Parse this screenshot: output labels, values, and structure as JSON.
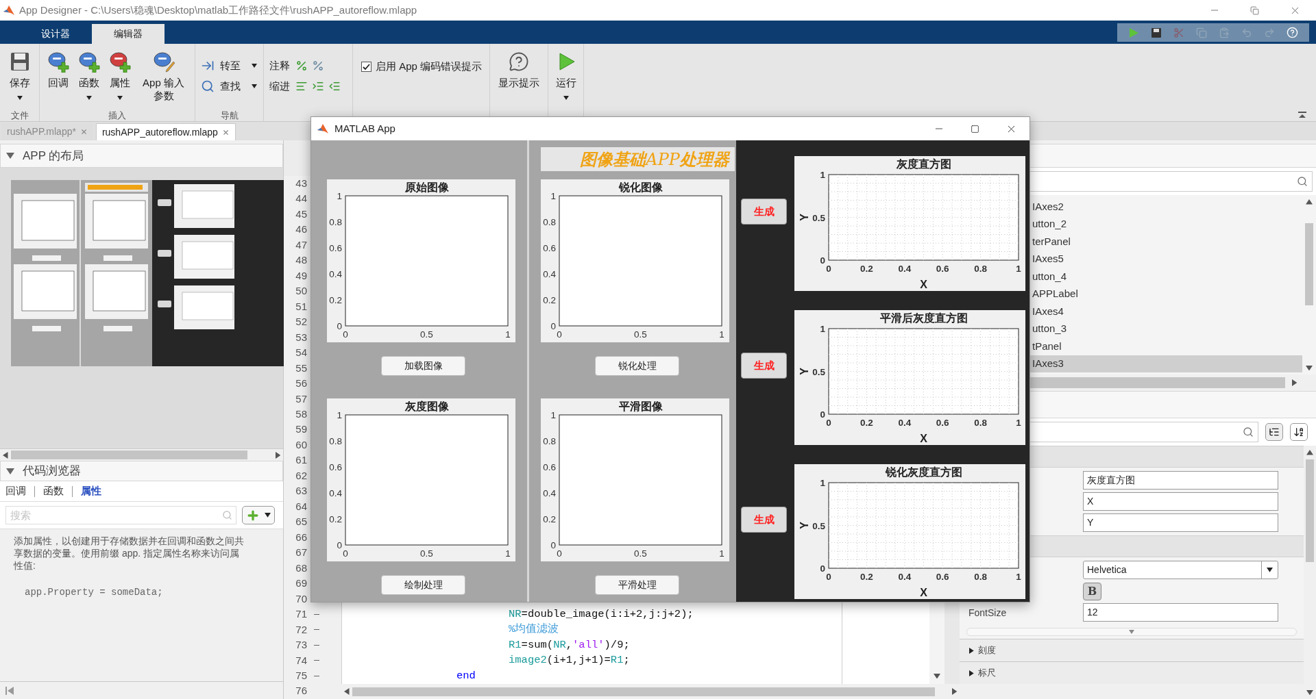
{
  "window": {
    "title": "App Designer - C:\\Users\\稳魂\\Desktop\\matlab工作路径文件\\rushAPP_autoreflow.mlapp"
  },
  "main_tabs": [
    {
      "label": "设计器",
      "selected": false
    },
    {
      "label": "编辑器",
      "selected": true
    }
  ],
  "ribbon": {
    "groups": [
      {
        "kind": "large",
        "label": "文件",
        "buttons": [
          {
            "label": "保存",
            "menu": true
          }
        ]
      },
      {
        "kind": "large",
        "label": "插入",
        "buttons": [
          {
            "label": "回调",
            "menu": false
          },
          {
            "label": "函数",
            "menu": true
          },
          {
            "label": "属性",
            "menu": true
          },
          {
            "label": "App 输入参数",
            "menu": false
          }
        ]
      },
      {
        "kind": "small",
        "label": "导航",
        "buttons": [
          {
            "label": "转至",
            "menu": true
          },
          {
            "label": "查找",
            "menu": true
          }
        ]
      },
      {
        "kind": "edit",
        "buttons": [
          {
            "label": "注释"
          },
          {
            "label": "缩进"
          }
        ]
      },
      {
        "kind": "check",
        "checkbox": {
          "label": "启用 App 编码错误提示",
          "checked": true
        }
      },
      {
        "kind": "large",
        "buttons": [
          {
            "label": "显示提示",
            "menu": false
          }
        ]
      },
      {
        "kind": "large",
        "buttons": [
          {
            "label": "运行",
            "menu": true
          }
        ]
      }
    ]
  },
  "file_tabs": [
    {
      "label": "rushAPP.mlapp*",
      "selected": false
    },
    {
      "label": "rushAPP_autoreflow.mlapp",
      "selected": true
    }
  ],
  "layout_panel": {
    "title": "APP 的布局",
    "expanded": true
  },
  "code_browser": {
    "title": "代码浏览器",
    "expanded": true,
    "tabs": [
      {
        "label": "回调",
        "selected": false
      },
      {
        "label": "函数",
        "selected": false
      },
      {
        "label": "属性",
        "selected": true
      }
    ],
    "search": {
      "placeholder": "搜索"
    },
    "description": "添加属性，以创建用于存储数据并在回调和函数之间共享数据的变量。使用前缀 app. 指定属性名称来访问属性值:",
    "example": "app.Property = someData;"
  },
  "editor": {
    "rows": [
      {
        "number": "43"
      },
      {
        "number": "44"
      },
      {
        "number": "45"
      },
      {
        "number": "46"
      },
      {
        "number": "47"
      },
      {
        "number": "48"
      },
      {
        "number": "49"
      },
      {
        "number": "50"
      },
      {
        "number": "51"
      },
      {
        "number": "52"
      },
      {
        "number": "53"
      },
      {
        "number": "54"
      },
      {
        "number": "55"
      },
      {
        "number": "56"
      },
      {
        "number": "57"
      },
      {
        "number": "58"
      },
      {
        "number": "59"
      },
      {
        "number": "60"
      },
      {
        "number": "61"
      },
      {
        "number": "62"
      },
      {
        "number": "63"
      },
      {
        "number": "64"
      },
      {
        "number": "65"
      },
      {
        "number": "66"
      },
      {
        "number": "67"
      },
      {
        "number": "68"
      },
      {
        "number": "69"
      },
      {
        "number": "70"
      },
      {
        "number": "71",
        "code": {
          "kind": "body",
          "tokens": [
            {
              "kind": "var",
              "text": "NR"
            },
            {
              "kind": "plain",
              "text": "=double_image(i:i+2,j:j+2);"
            }
          ]
        }
      },
      {
        "number": "72",
        "code": {
          "kind": "body",
          "tokens": [
            {
              "kind": "comment",
              "text": "%均值滤波"
            }
          ]
        }
      },
      {
        "number": "73",
        "code": {
          "kind": "body",
          "tokens": [
            {
              "kind": "var",
              "text": "R1"
            },
            {
              "kind": "plain",
              "text": "=sum("
            },
            {
              "kind": "var",
              "text": "NR"
            },
            {
              "kind": "plain",
              "text": ","
            },
            {
              "kind": "string",
              "text": "'all'"
            },
            {
              "kind": "plain",
              "text": ")/9;"
            }
          ]
        }
      },
      {
        "number": "74",
        "code": {
          "kind": "body",
          "tokens": [
            {
              "kind": "var",
              "text": "image2"
            },
            {
              "kind": "plain",
              "text": "(i+1,j+1)="
            },
            {
              "kind": "var",
              "text": "R1"
            },
            {
              "kind": "plain",
              "text": ";"
            }
          ]
        }
      },
      {
        "number": "75",
        "code": {
          "kind": "close",
          "tokens": [
            {
              "kind": "keyword",
              "text": "end"
            }
          ]
        }
      },
      {
        "number": "76"
      }
    ]
  },
  "component_browser": {
    "items": [
      {
        "label": "IAxes2",
        "selected": false
      },
      {
        "label": "utton_2",
        "selected": false
      },
      {
        "label": "terPanel",
        "selected": false
      },
      {
        "label": "IAxes5",
        "selected": false
      },
      {
        "label": "utton_4",
        "selected": false
      },
      {
        "label": "APPLabel",
        "selected": false
      },
      {
        "label": "IAxes4",
        "selected": false
      },
      {
        "label": "utton_3",
        "selected": false
      },
      {
        "label": "tPanel",
        "selected": false
      },
      {
        "label": "IAxes3",
        "selected": true
      }
    ]
  },
  "inspector": {
    "groups": [
      {
        "fields": [
          {
            "kind": "text",
            "value": "灰度直方图"
          },
          {
            "kind": "text",
            "value": "X"
          },
          {
            "kind": "text",
            "value": "Y"
          }
        ]
      },
      {
        "fields": [
          {
            "kind": "dropdown",
            "value": "Helvetica"
          },
          {
            "kind": "toggle",
            "value": "B",
            "on": true
          },
          {
            "kind": "labeled",
            "label": "FontSize",
            "value": "12"
          }
        ]
      }
    ],
    "sections": [
      {
        "label": "刻度",
        "expanded": false
      },
      {
        "label": "标尺",
        "expanded": false
      }
    ]
  },
  "app_window": {
    "title": "MATLAB App",
    "columns": [
      {
        "cells": [
          {
            "button": "加载图像",
            "chart_data": {
              "type": "line",
              "title": "原始图像",
              "xlim": [
                0,
                1
              ],
              "ylim": [
                0,
                1
              ],
              "xticks": [
                0,
                0.5,
                1
              ],
              "yticks": [
                0,
                0.2,
                0.4,
                0.6,
                0.8,
                1
              ]
            }
          },
          {
            "button": "绘制处理",
            "chart_data": {
              "type": "line",
              "title": "灰度图像",
              "xlim": [
                0,
                1
              ],
              "ylim": [
                0,
                1
              ],
              "xticks": [
                0,
                0.5,
                1
              ],
              "yticks": [
                0,
                0.2,
                0.4,
                0.6,
                0.8,
                1
              ]
            }
          }
        ]
      },
      {
        "banner": "**图像基础**APP**处理器**",
        "cells": [
          {
            "button": "锐化处理",
            "chart_data": {
              "type": "line",
              "title": "锐化图像",
              "xlim": [
                0,
                1
              ],
              "ylim": [
                0,
                1
              ],
              "xticks": [
                0,
                0.5,
                1
              ],
              "yticks": [
                0,
                0.2,
                0.4,
                0.6,
                0.8,
                1
              ]
            }
          },
          {
            "button": "平滑处理",
            "chart_data": {
              "type": "line",
              "title": "平滑图像",
              "xlim": [
                0,
                1
              ],
              "ylim": [
                0,
                1
              ],
              "xticks": [
                0,
                0.5,
                1
              ],
              "yticks": [
                0,
                0.2,
                0.4,
                0.6,
                0.8,
                1
              ]
            }
          }
        ]
      }
    ],
    "histograms": [
      {
        "button": "生成",
        "chart_data": {
          "type": "line",
          "grid": true,
          "title": "灰度直方图",
          "xlabel": "X",
          "ylabel": "Y",
          "xlim": [
            0,
            1
          ],
          "ylim": [
            0,
            1
          ],
          "xticks": [
            0,
            0.2,
            0.4,
            0.6,
            0.8,
            1
          ],
          "yticks": [
            0,
            0.5,
            1
          ]
        }
      },
      {
        "button": "生成",
        "chart_data": {
          "type": "line",
          "grid": true,
          "title": "平滑后灰度直方图",
          "xlabel": "X",
          "ylabel": "Y",
          "xlim": [
            0,
            1
          ],
          "ylim": [
            0,
            1
          ],
          "xticks": [
            0,
            0.2,
            0.4,
            0.6,
            0.8,
            1
          ],
          "yticks": [
            0,
            0.5,
            1
          ]
        }
      },
      {
        "button": "生成",
        "chart_data": {
          "type": "line",
          "grid": true,
          "title": "锐化灰度直方图",
          "xlabel": "X",
          "ylabel": "Y",
          "xlim": [
            0,
            1
          ],
          "ylim": [
            0,
            1
          ],
          "xticks": [
            0,
            0.2,
            0.4,
            0.6,
            0.8,
            1
          ],
          "yticks": [
            0,
            0.5,
            1
          ]
        }
      }
    ]
  }
}
